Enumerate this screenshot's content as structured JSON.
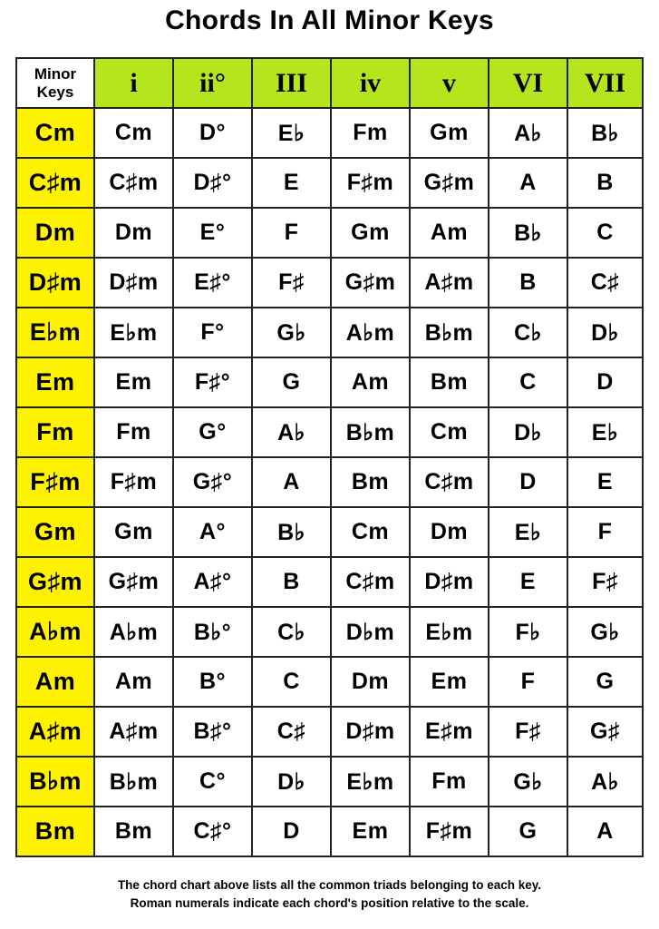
{
  "title": "Chords In All Minor Keys",
  "table": {
    "corner_label_line1": "Minor",
    "corner_label_line2": "Keys",
    "degrees": [
      "i",
      "ii°",
      "III",
      "iv",
      "v",
      "VI",
      "VII"
    ],
    "rows": [
      {
        "key": "Cm",
        "chords": [
          "Cm",
          "D°",
          "E♭",
          "Fm",
          "Gm",
          "A♭",
          "B♭"
        ]
      },
      {
        "key": "C♯m",
        "chords": [
          "C♯m",
          "D♯°",
          "E",
          "F♯m",
          "G♯m",
          "A",
          "B"
        ]
      },
      {
        "key": "Dm",
        "chords": [
          "Dm",
          "E°",
          "F",
          "Gm",
          "Am",
          "B♭",
          "C"
        ]
      },
      {
        "key": "D♯m",
        "chords": [
          "D♯m",
          "E♯°",
          "F♯",
          "G♯m",
          "A♯m",
          "B",
          "C♯"
        ]
      },
      {
        "key": "E♭m",
        "chords": [
          "E♭m",
          "F°",
          "G♭",
          "A♭m",
          "B♭m",
          "C♭",
          "D♭"
        ]
      },
      {
        "key": "Em",
        "chords": [
          "Em",
          "F♯°",
          "G",
          "Am",
          "Bm",
          "C",
          "D"
        ]
      },
      {
        "key": "Fm",
        "chords": [
          "Fm",
          "G°",
          "A♭",
          "B♭m",
          "Cm",
          "D♭",
          "E♭"
        ]
      },
      {
        "key": "F♯m",
        "chords": [
          "F♯m",
          "G♯°",
          "A",
          "Bm",
          "C♯m",
          "D",
          "E"
        ]
      },
      {
        "key": "Gm",
        "chords": [
          "Gm",
          "A°",
          "B♭",
          "Cm",
          "Dm",
          "E♭",
          "F"
        ]
      },
      {
        "key": "G♯m",
        "chords": [
          "G♯m",
          "A♯°",
          "B",
          "C♯m",
          "D♯m",
          "E",
          "F♯"
        ]
      },
      {
        "key": "A♭m",
        "chords": [
          "A♭m",
          "B♭°",
          "C♭",
          "D♭m",
          "E♭m",
          "F♭",
          "G♭"
        ]
      },
      {
        "key": "Am",
        "chords": [
          "Am",
          "B°",
          "C",
          "Dm",
          "Em",
          "F",
          "G"
        ]
      },
      {
        "key": "A♯m",
        "chords": [
          "A♯m",
          "B♯°",
          "C♯",
          "D♯m",
          "E♯m",
          "F♯",
          "G♯"
        ]
      },
      {
        "key": "B♭m",
        "chords": [
          "B♭m",
          "C°",
          "D♭",
          "E♭m",
          "Fm",
          "G♭",
          "A♭"
        ]
      },
      {
        "key": "Bm",
        "chords": [
          "Bm",
          "C♯°",
          "D",
          "Em",
          "F♯m",
          "G",
          "A"
        ]
      }
    ]
  },
  "colors": {
    "header_green": "#b5e61d",
    "key_yellow": "#fff200",
    "grid_line": "#222222"
  },
  "footer": {
    "line1": "The chord chart above lists all the common triads belonging to each key.",
    "line2": "Roman numerals indicate each chord's position relative to the scale."
  }
}
